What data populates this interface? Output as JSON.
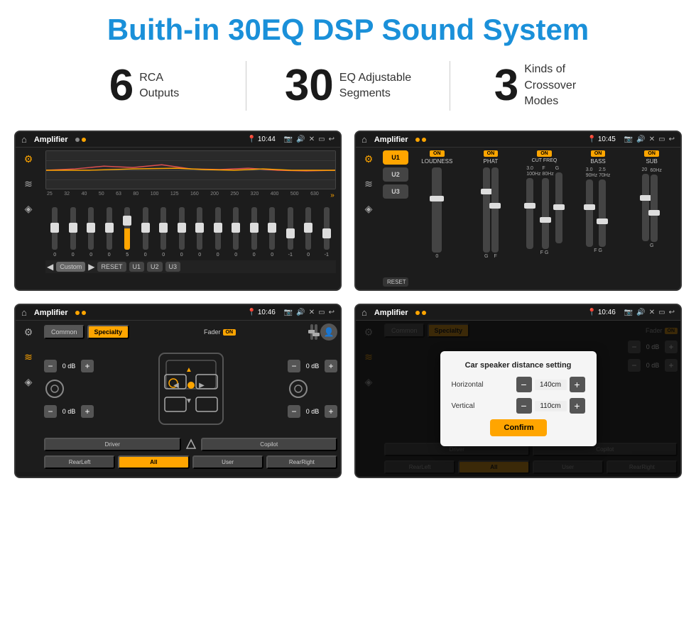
{
  "header": {
    "title": "Buith-in 30EQ DSP Sound System"
  },
  "stats": [
    {
      "number": "6",
      "desc_line1": "RCA",
      "desc_line2": "Outputs"
    },
    {
      "number": "30",
      "desc_line1": "EQ Adjustable",
      "desc_line2": "Segments"
    },
    {
      "number": "3",
      "desc_line1": "Kinds of",
      "desc_line2": "Crossover Modes"
    }
  ],
  "screens": [
    {
      "id": "eq-screen",
      "status_bar": {
        "app": "Amplifier",
        "time": "10:44"
      },
      "type": "equalizer"
    },
    {
      "id": "crossover-screen",
      "status_bar": {
        "app": "Amplifier",
        "time": "10:45"
      },
      "type": "crossover"
    },
    {
      "id": "fader-screen",
      "status_bar": {
        "app": "Amplifier",
        "time": "10:46"
      },
      "type": "fader"
    },
    {
      "id": "dialog-screen",
      "status_bar": {
        "app": "Amplifier",
        "time": "10:46"
      },
      "type": "dialog",
      "dialog": {
        "title": "Car speaker distance setting",
        "horizontal_label": "Horizontal",
        "horizontal_value": "140cm",
        "vertical_label": "Vertical",
        "vertical_value": "110cm",
        "confirm_label": "Confirm"
      }
    }
  ],
  "eq": {
    "freqs": [
      "25",
      "32",
      "40",
      "50",
      "63",
      "80",
      "100",
      "125",
      "160",
      "200",
      "250",
      "320",
      "400",
      "500",
      "630"
    ],
    "values": [
      "0",
      "0",
      "0",
      "0",
      "5",
      "0",
      "0",
      "0",
      "0",
      "0",
      "0",
      "0",
      "0",
      "-1",
      "0",
      "-1"
    ],
    "buttons": [
      "Custom",
      "RESET",
      "U1",
      "U2",
      "U3"
    ]
  },
  "crossover": {
    "u_buttons": [
      "U1",
      "U2",
      "U3"
    ],
    "channels": [
      "LOUDNESS",
      "PHAT",
      "CUT FREQ",
      "BASS",
      "SUB"
    ],
    "reset_label": "RESET"
  },
  "fader": {
    "tabs": [
      "Common",
      "Specialty"
    ],
    "fader_label": "Fader",
    "on_label": "ON",
    "speaker_positions": [
      "Driver",
      "Copilot",
      "RearLeft",
      "All",
      "User",
      "RearRight"
    ],
    "vol_labels": [
      "0 dB",
      "0 dB",
      "0 dB",
      "0 dB"
    ]
  },
  "dialog_screen": {
    "tabs": [
      "Common",
      "Specialty"
    ],
    "dialog_title": "Car speaker distance setting",
    "horizontal_label": "Horizontal",
    "horizontal_value": "140cm",
    "vertical_label": "Vertical",
    "vertical_value": "110cm",
    "confirm_label": "Confirm",
    "right_controls": [
      "0 dB",
      "0 dB"
    ]
  }
}
